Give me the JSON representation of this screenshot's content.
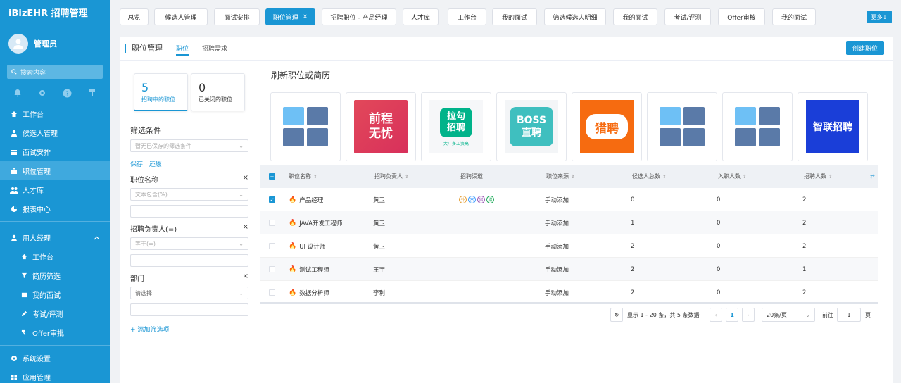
{
  "sidebar": {
    "brand": "iBizEHR 招聘管理",
    "user": "管理员",
    "search_placeholder": "搜索内容",
    "tool_icons": [
      "bell-icon",
      "gear-icon",
      "help-icon",
      "paint-roller-icon"
    ],
    "items": [
      {
        "label": "工作台",
        "icon": "home-icon"
      },
      {
        "label": "候选人管理",
        "icon": "user-icon"
      },
      {
        "label": "面试安排",
        "icon": "calendar-icon"
      },
      {
        "label": "职位管理",
        "icon": "briefcase-icon",
        "active": true
      },
      {
        "label": "人才库",
        "icon": "users-icon"
      },
      {
        "label": "报表中心",
        "icon": "chart-icon"
      }
    ],
    "group": {
      "label": "用人经理",
      "icon": "person-icon"
    },
    "sub_items": [
      {
        "label": "工作台",
        "icon": "home-icon"
      },
      {
        "label": "简历筛选",
        "icon": "filter-icon"
      },
      {
        "label": "我的面试",
        "icon": "calendar-icon"
      },
      {
        "label": "考试/评测",
        "icon": "pencil-icon"
      },
      {
        "label": "Offer审批",
        "icon": "hammer-icon"
      }
    ],
    "bottom_items": [
      {
        "label": "系统设置",
        "icon": "gear-icon"
      },
      {
        "label": "应用管理",
        "icon": "apps-icon"
      }
    ]
  },
  "tabs": [
    {
      "label": "总览"
    },
    {
      "label": "候选人管理"
    },
    {
      "label": "面试安排"
    },
    {
      "label": "职位管理",
      "active": true
    },
    {
      "label": "招聘职位 - 产品经理"
    },
    {
      "label": "人才库"
    },
    {
      "label": "工作台"
    },
    {
      "label": "我的面试"
    },
    {
      "label": "筛选候选人明细"
    },
    {
      "label": "我的面试"
    },
    {
      "label": "考试/评测"
    },
    {
      "label": "Offer审核"
    },
    {
      "label": "我的面试"
    }
  ],
  "more_button": "更多",
  "page": {
    "title": "职位管理",
    "sub_tabs": [
      "职位",
      "招聘需求"
    ],
    "create_button": "创建职位"
  },
  "stats": [
    {
      "num": "5",
      "label": "招聘中的职位"
    },
    {
      "num": "0",
      "label": "已关闭的职位"
    }
  ],
  "filter": {
    "title": "筛选条件",
    "saved_placeholder": "暂无已保存的筛选条件",
    "save": "保存",
    "reset": "还原",
    "fields": [
      {
        "label": "职位名称",
        "operator": "文本包含(%)"
      },
      {
        "label": "招聘负责人(=)",
        "operator": "等于(=)"
      },
      {
        "label": "部门",
        "operator": "请选择"
      }
    ],
    "add": "+ 添加筛选项"
  },
  "refresh_title": "刷新职位或简历",
  "channels": [
    {
      "name": "placeholder"
    },
    {
      "name": "前程无忧",
      "text": "前程\n无忧",
      "color": "#e2485a"
    },
    {
      "name": "拉勾招聘",
      "text": "拉勾\n招聘",
      "sub": "大厂多工资高",
      "color": "#00b38a"
    },
    {
      "name": "BOSS直聘",
      "text": "BOSS\n直聘",
      "color": "#3fbfbf"
    },
    {
      "name": "猎聘",
      "text": "猎聘",
      "color": "#f66b10"
    },
    {
      "name": "placeholder"
    },
    {
      "name": "placeholder"
    },
    {
      "name": "智联招聘",
      "text": "智联招聘",
      "color": "#1a3ed8"
    }
  ],
  "table": {
    "columns": [
      "职位名称",
      "招聘负责人",
      "招聘渠道",
      "职位来源",
      "候选人总数",
      "入职人数",
      "招聘人数"
    ],
    "header_extra": "⇄",
    "rows": [
      {
        "name": "产品经理",
        "owner": "黄卫",
        "channels": [
          "外",
          "赏",
          "猎",
          "猎"
        ],
        "source": "手动添加",
        "candidates": "0",
        "hired": "0",
        "quota": "2",
        "checked": true
      },
      {
        "name": "JAVA开发工程师",
        "owner": "黄卫",
        "channels": [],
        "source": "手动添加",
        "candidates": "1",
        "hired": "0",
        "quota": "2",
        "checked": false
      },
      {
        "name": "UI 设计师",
        "owner": "黄卫",
        "channels": [],
        "source": "手动添加",
        "candidates": "2",
        "hired": "0",
        "quota": "2",
        "checked": false
      },
      {
        "name": "测试工程师",
        "owner": "王宇",
        "channels": [],
        "source": "手动添加",
        "candidates": "2",
        "hired": "0",
        "quota": "1",
        "checked": false
      },
      {
        "name": "数据分析师",
        "owner": "李利",
        "channels": [],
        "source": "手动添加",
        "candidates": "2",
        "hired": "0",
        "quota": "2",
        "checked": false
      }
    ]
  },
  "pagination": {
    "summary": "显示 1 - 20 条，共 5 条数据",
    "current_page": "1",
    "page_size": "20条/页",
    "goto_label": "前往",
    "goto_value": "1",
    "page_unit": "页"
  }
}
